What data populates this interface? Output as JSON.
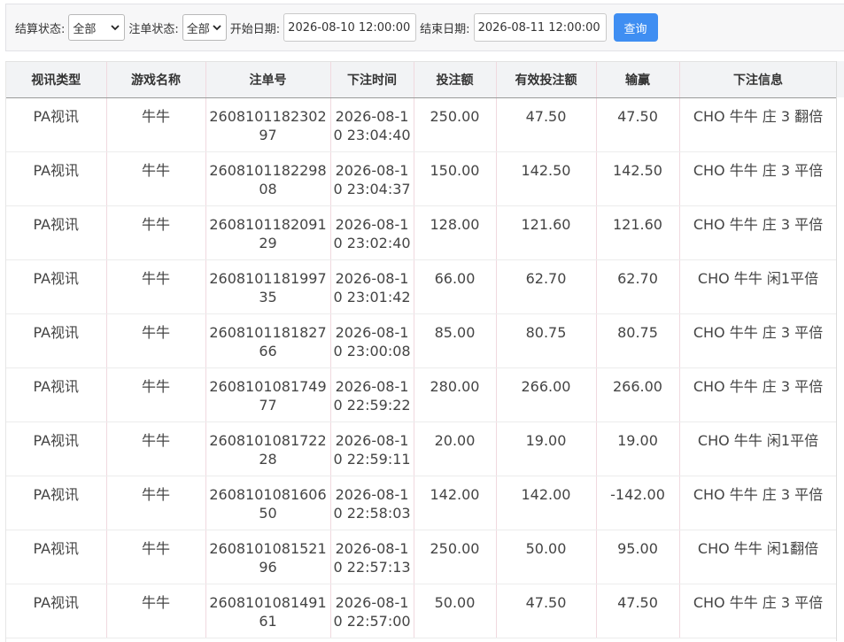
{
  "filters": {
    "settle_label": "结算状态:",
    "settle_value": "全部",
    "order_label": "注单状态:",
    "order_value": "全部",
    "start_label": "开始日期:",
    "start_value": "2026-08-10 12:00:00",
    "end_label": "结束日期:",
    "end_value": "2026-08-11 12:00:00",
    "query_label": "查询"
  },
  "table": {
    "columns": [
      "视讯类型",
      "游戏名称",
      "注单号",
      "下注时间",
      "投注额",
      "有效投注额",
      "输赢",
      "下注信息"
    ],
    "rows": [
      [
        "PA视讯",
        "牛牛",
        "260810118230297",
        "2026-08-10 23:04:40",
        "250.00",
        "47.50",
        "47.50",
        "CHO 牛牛 庄 3 翻倍"
      ],
      [
        "PA视讯",
        "牛牛",
        "260810118229808",
        "2026-08-10 23:04:37",
        "150.00",
        "142.50",
        "142.50",
        "CHO 牛牛 庄 3 平倍"
      ],
      [
        "PA视讯",
        "牛牛",
        "260810118209129",
        "2026-08-10 23:02:40",
        "128.00",
        "121.60",
        "121.60",
        "CHO 牛牛 庄 3 平倍"
      ],
      [
        "PA视讯",
        "牛牛",
        "260810118199735",
        "2026-08-10 23:01:42",
        "66.00",
        "62.70",
        "62.70",
        "CHO 牛牛 闲1平倍"
      ],
      [
        "PA视讯",
        "牛牛",
        "260810118182766",
        "2026-08-10 23:00:08",
        "85.00",
        "80.75",
        "80.75",
        "CHO 牛牛 庄 3 平倍"
      ],
      [
        "PA视讯",
        "牛牛",
        "260810108174977",
        "2026-08-10 22:59:22",
        "280.00",
        "266.00",
        "266.00",
        "CHO 牛牛 庄 3 平倍"
      ],
      [
        "PA视讯",
        "牛牛",
        "260810108172228",
        "2026-08-10 22:59:11",
        "20.00",
        "19.00",
        "19.00",
        "CHO 牛牛 闲1平倍"
      ],
      [
        "PA视讯",
        "牛牛",
        "260810108160650",
        "2026-08-10 22:58:03",
        "142.00",
        "142.00",
        "-142.00",
        "CHO 牛牛 庄 3 平倍"
      ],
      [
        "PA视讯",
        "牛牛",
        "260810108152196",
        "2026-08-10 22:57:13",
        "250.00",
        "50.00",
        "95.00",
        "CHO 牛牛 闲1翻倍"
      ],
      [
        "PA视讯",
        "牛牛",
        "260810108149161",
        "2026-08-10 22:57:00",
        "50.00",
        "47.50",
        "47.50",
        "CHO 牛牛 庄 3 平倍"
      ]
    ]
  }
}
